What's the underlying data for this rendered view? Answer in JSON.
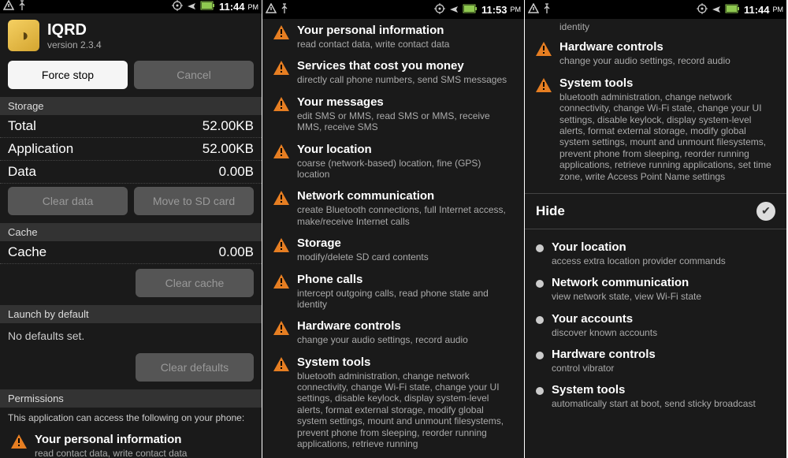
{
  "status_bar": {
    "time1": "11:44",
    "time2": "11:53",
    "time3": "11:44",
    "ampm": "PM"
  },
  "screen1": {
    "app_name": "IQRD",
    "version": "version 2.3.4",
    "force_stop": "Force stop",
    "cancel": "Cancel",
    "storage_header": "Storage",
    "total_label": "Total",
    "total_value": "52.00KB",
    "application_label": "Application",
    "application_value": "52.00KB",
    "data_label": "Data",
    "data_value": "0.00B",
    "clear_data": "Clear data",
    "move_sd": "Move to SD card",
    "cache_header": "Cache",
    "cache_label": "Cache",
    "cache_value": "0.00B",
    "clear_cache": "Clear cache",
    "launch_header": "Launch by default",
    "no_defaults": "No defaults set.",
    "clear_defaults": "Clear defaults",
    "permissions_header": "Permissions",
    "permissions_intro": "This application can access the following on your phone:",
    "perm1_title": "Your personal information",
    "perm1_desc": "read contact data, write contact data"
  },
  "screen2": {
    "perms": [
      {
        "title": "Your personal information",
        "desc": "read contact data, write contact data"
      },
      {
        "title": "Services that cost you money",
        "desc": "directly call phone numbers, send SMS messages"
      },
      {
        "title": "Your messages",
        "desc": "edit SMS or MMS, read SMS or MMS, receive MMS, receive SMS"
      },
      {
        "title": "Your location",
        "desc": "coarse (network-based) location, fine (GPS) location"
      },
      {
        "title": "Network communication",
        "desc": "create Bluetooth connections, full Internet access, make/receive Internet calls"
      },
      {
        "title": "Storage",
        "desc": "modify/delete SD card contents"
      },
      {
        "title": "Phone calls",
        "desc": "intercept outgoing calls, read phone state and identity"
      },
      {
        "title": "Hardware controls",
        "desc": "change your audio settings, record audio"
      },
      {
        "title": "System tools",
        "desc": "bluetooth administration, change network connectivity, change Wi-Fi state, change your UI settings, disable keylock, display system-level alerts, format external storage, modify global system settings, mount and unmount filesystems, prevent phone from sleeping, reorder running applications, retrieve running"
      }
    ]
  },
  "screen3": {
    "top_desc": "identity",
    "top_perms": [
      {
        "title": "Hardware controls",
        "desc": "change your audio settings, record audio"
      },
      {
        "title": "System tools",
        "desc": "bluetooth administration, change network connectivity, change Wi-Fi state, change your UI settings, disable keylock, display system-level alerts, format external storage, modify global system settings, mount and unmount filesystems, prevent phone from sleeping, reorder running applications, retrieve running applications, set time zone, write Access Point Name settings"
      }
    ],
    "hide": "Hide",
    "bullet_perms": [
      {
        "title": "Your location",
        "desc": "access extra location provider commands"
      },
      {
        "title": "Network communication",
        "desc": "view network state, view Wi-Fi state"
      },
      {
        "title": "Your accounts",
        "desc": "discover known accounts"
      },
      {
        "title": "Hardware controls",
        "desc": "control vibrator"
      },
      {
        "title": "System tools",
        "desc": "automatically start at boot, send sticky broadcast"
      }
    ]
  }
}
